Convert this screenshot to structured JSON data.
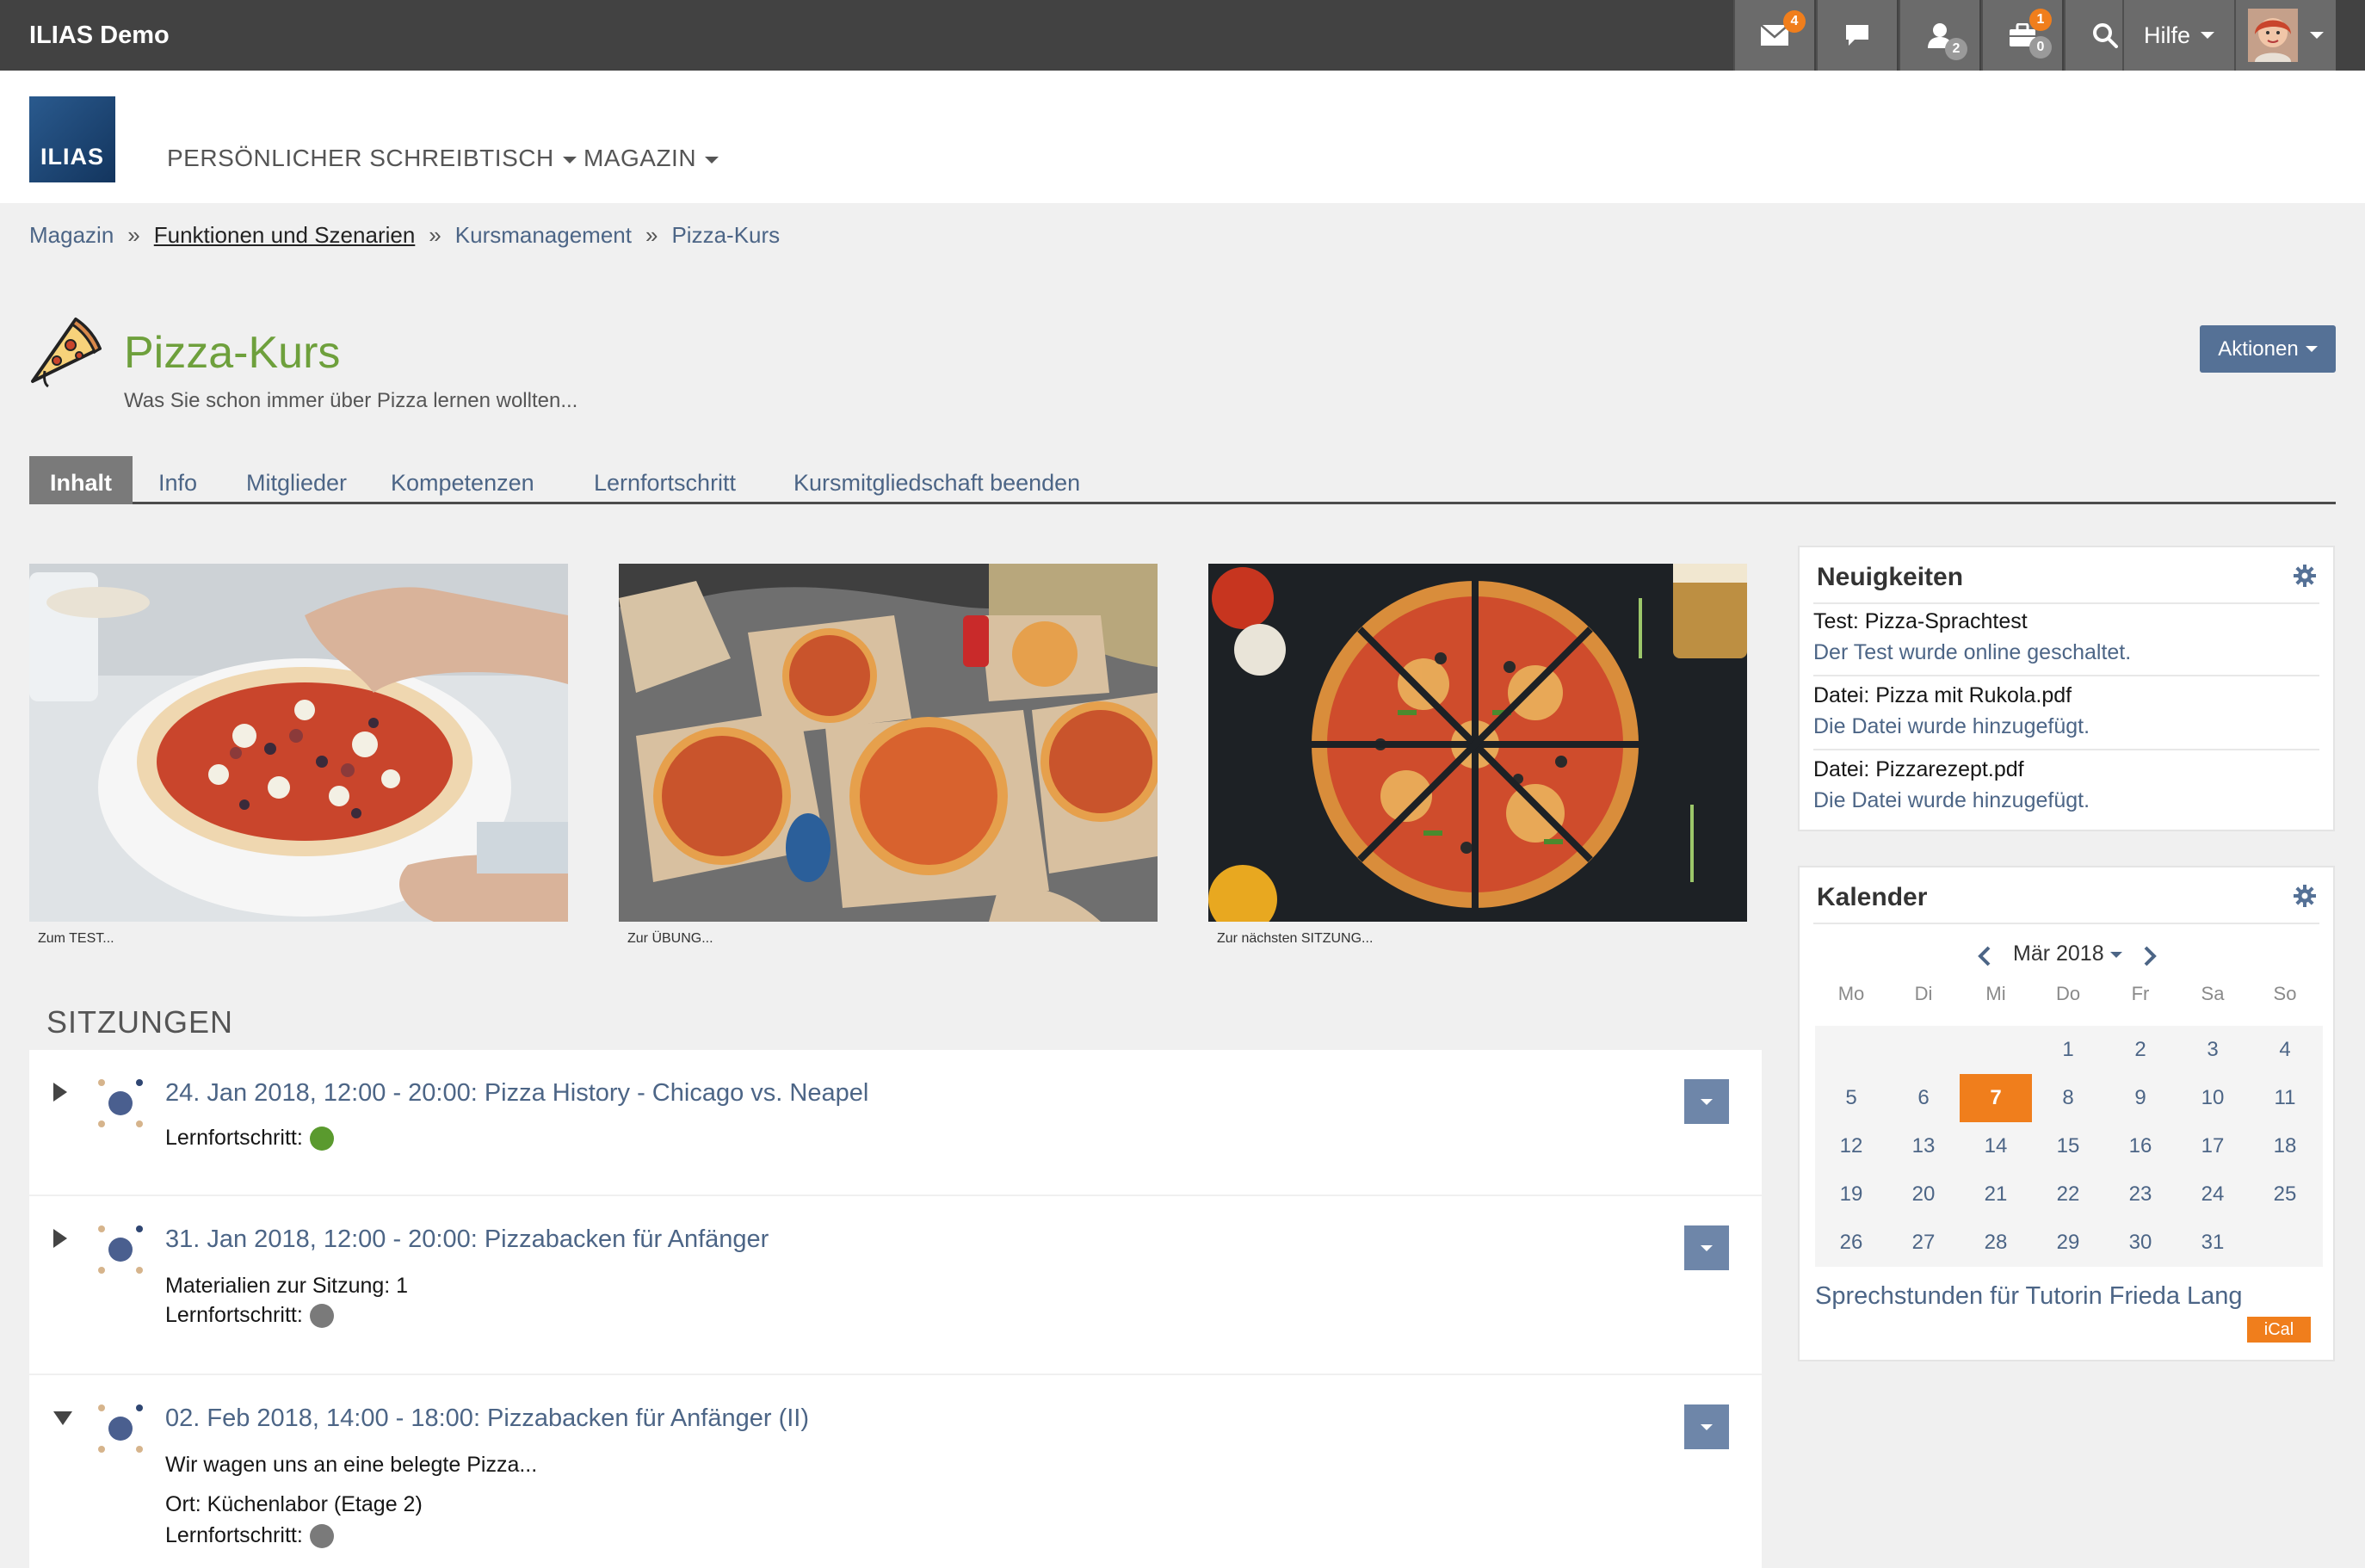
{
  "topbar": {
    "brand": "ILIAS Demo",
    "mail_count": "4",
    "contacts_count": "2",
    "tasks_badge_top": "1",
    "tasks_badge_bottom": "0",
    "help_label": "Hilfe"
  },
  "header": {
    "logo_text": "ILIAS",
    "menu": [
      "PERSÖNLICHER SCHREIBTISCH",
      "MAGAZIN"
    ]
  },
  "breadcrumb": [
    "Magazin",
    "Funktionen und Szenarien",
    "Kursmanagement",
    "Pizza-Kurs"
  ],
  "breadcrumb_sep": "»",
  "page": {
    "title": "Pizza-Kurs",
    "description": "Was Sie schon immer über Pizza lernen wollten...",
    "actions_label": "Aktionen"
  },
  "tabs": [
    {
      "label": "Inhalt",
      "active": true
    },
    {
      "label": "Info",
      "active": false
    },
    {
      "label": "Mitglieder",
      "active": false
    },
    {
      "label": "Kompetenzen",
      "active": false
    },
    {
      "label": "Lernfortschritt",
      "active": false
    },
    {
      "label": "Kursmitgliedschaft beenden",
      "active": false
    }
  ],
  "tiles": [
    {
      "caption": "Zum TEST..."
    },
    {
      "caption": "Zur ÜBUNG..."
    },
    {
      "caption": "Zur nächsten SITZUNG..."
    }
  ],
  "sessions": {
    "heading": "SITZUNGEN",
    "items": [
      {
        "title": "24. Jan 2018, 12:00 - 20:00: Pizza History - Chicago vs. Neapel",
        "expanded": false,
        "lines": [],
        "progress_label": "Lernfortschritt:",
        "progress_color": "#5a9a2e"
      },
      {
        "title": "31. Jan 2018, 12:00 - 20:00: Pizzabacken für Anfänger",
        "expanded": false,
        "lines": [
          "Materialien zur Sitzung: 1"
        ],
        "progress_label": "Lernfortschritt:",
        "progress_color": "#7a7a7a"
      },
      {
        "title": "02. Feb 2018, 14:00 - 18:00: Pizzabacken für Anfänger (II)",
        "expanded": true,
        "lines": [
          "Wir wagen uns an eine belegte Pizza...",
          "Ort: Küchenlabor (Etage 2)"
        ],
        "progress_label": "Lernfortschritt:",
        "progress_color": "#7a7a7a"
      }
    ]
  },
  "news": {
    "heading": "Neuigkeiten",
    "items": [
      {
        "title": "Test: Pizza-Sprachtest",
        "status": "Der Test wurde online geschaltet."
      },
      {
        "title": "Datei: Pizza mit Rukola.pdf",
        "status": "Die Datei wurde hinzugefügt."
      },
      {
        "title": "Datei: Pizzarezept.pdf",
        "status": "Die Datei wurde hinzugefügt."
      }
    ]
  },
  "calendar": {
    "heading": "Kalender",
    "month_label": "Mär 2018",
    "weekdays": [
      "Mo",
      "Di",
      "Mi",
      "Do",
      "Fr",
      "Sa",
      "So"
    ],
    "first_weekday_index": 3,
    "days_in_month": 31,
    "today": 7,
    "link": "Sprechstunden für Tutorin Frieda Lang",
    "ical_label": "iCal"
  },
  "colors": {
    "accent": "#f07e1c",
    "link": "#4c6586",
    "title_green": "#6ea03c",
    "button_blue": "#557196"
  }
}
